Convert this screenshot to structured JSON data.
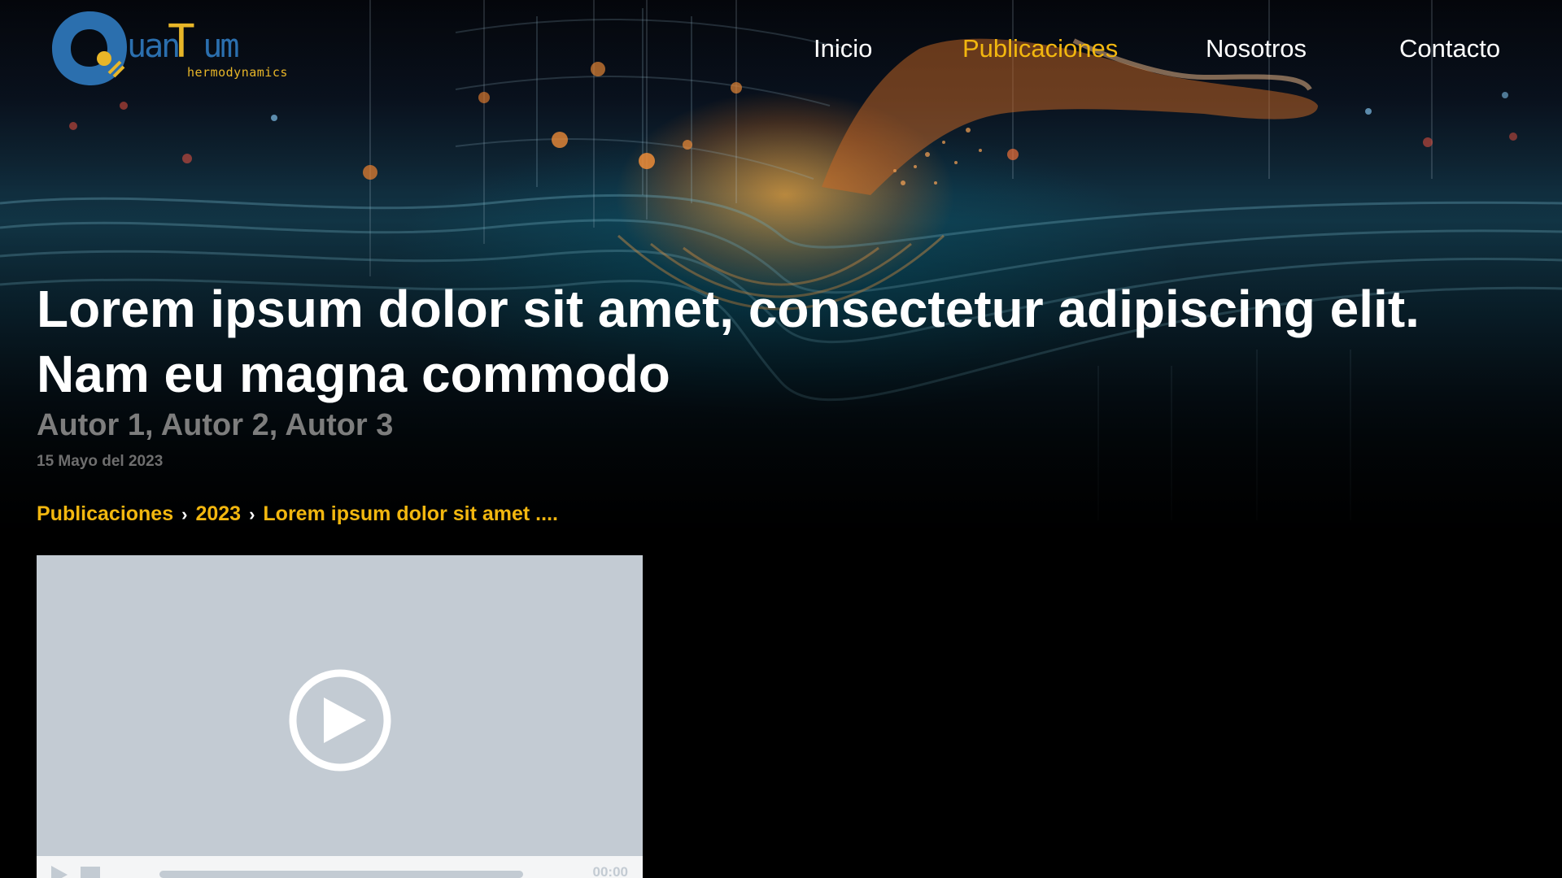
{
  "header": {
    "logo": {
      "word": "uan",
      "word_tail": "um",
      "letter_t": "T",
      "subtitle": "hermodynamics",
      "colors": {
        "ring": "#2b6fae",
        "accent": "#e8b628"
      }
    },
    "nav": [
      {
        "label": "Inicio",
        "active": false
      },
      {
        "label": "Publicaciones",
        "active": true
      },
      {
        "label": "Nosotros",
        "active": false
      },
      {
        "label": "Contacto",
        "active": false
      }
    ]
  },
  "article": {
    "title": "Lorem ipsum dolor sit amet, consectetur adipiscing elit. Nam eu magna commodo",
    "authors": "Autor 1, Autor 2, Autor 3",
    "date": "15 Mayo del 2023"
  },
  "breadcrumb": {
    "items": [
      "Publicaciones",
      "2023",
      "Lorem ipsum dolor sit amet ...."
    ],
    "separator_icon": "chevron-right-icon"
  },
  "video": {
    "time": "00:00",
    "progress": 0,
    "icons": [
      "play-circle-icon",
      "play-icon",
      "stop-icon"
    ]
  },
  "colors": {
    "accent": "#f2b70f",
    "background": "#000000",
    "title": "#ffffff",
    "authors": "#7d7d7d",
    "video_bg": "#c3cbd3"
  }
}
